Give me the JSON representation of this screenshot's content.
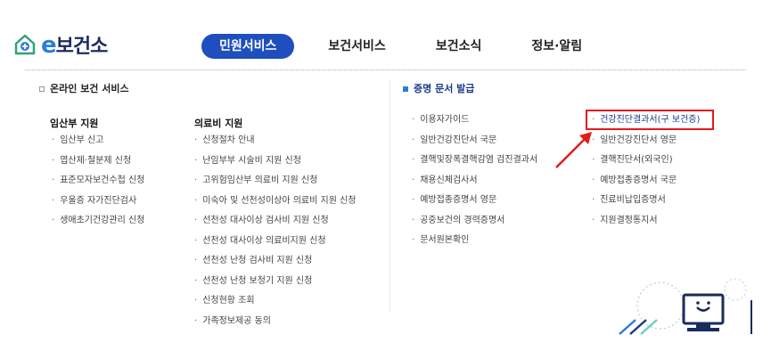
{
  "logo": {
    "e": "e",
    "name": "보건소"
  },
  "nav": [
    "민원서비스",
    "보건서비스",
    "보건소식",
    "정보·알림"
  ],
  "left_section": {
    "title": "온라인 보건 서비스",
    "col1": {
      "heading": "임산부 지원",
      "items": [
        "임산부 신고",
        "엽산제·철분제 신청",
        "표준모자보건수첩 신청",
        "우울증 자가진단검사",
        "생애초기건강관리 신청"
      ]
    },
    "col2": {
      "heading": "의료비 지원",
      "items": [
        "신청절차 안내",
        "난임부부 시술비 지원 신청",
        "고위험임산부 의료비 지원 신청",
        "미숙아 및 선천성이상아 의료비 지원 신청",
        "선천성 대사이상 검사비 지원 신청",
        "선천성 대사이상 의료비지원 신청",
        "선천성 난청 검사비 지원 신청",
        "선천성 난청 보청기 지원 신청",
        "신청현황 조회",
        "가족정보제공 동의"
      ]
    }
  },
  "right_section": {
    "title": "증명 문서 발급",
    "col1": [
      "이용자가이드",
      "일반건강진단서 국문",
      "결핵및장폭결핵감염 검진결과서",
      "채용신체검사서",
      "예방접종증명서 영문",
      "공중보건의 경력증명서",
      "문서원본확인"
    ],
    "col2": [
      "건강진단결과서(구 보건증)",
      "일반건강진단서 영문",
      "결핵진단서(외국인)",
      "예방접종증명서 국문",
      "진료비납입증명서",
      "지원결정통지서"
    ]
  },
  "colors": {
    "nav_active_bg": "#1f4fbf",
    "highlight_border": "#e21b1b",
    "accent": "#2c7ed6"
  }
}
